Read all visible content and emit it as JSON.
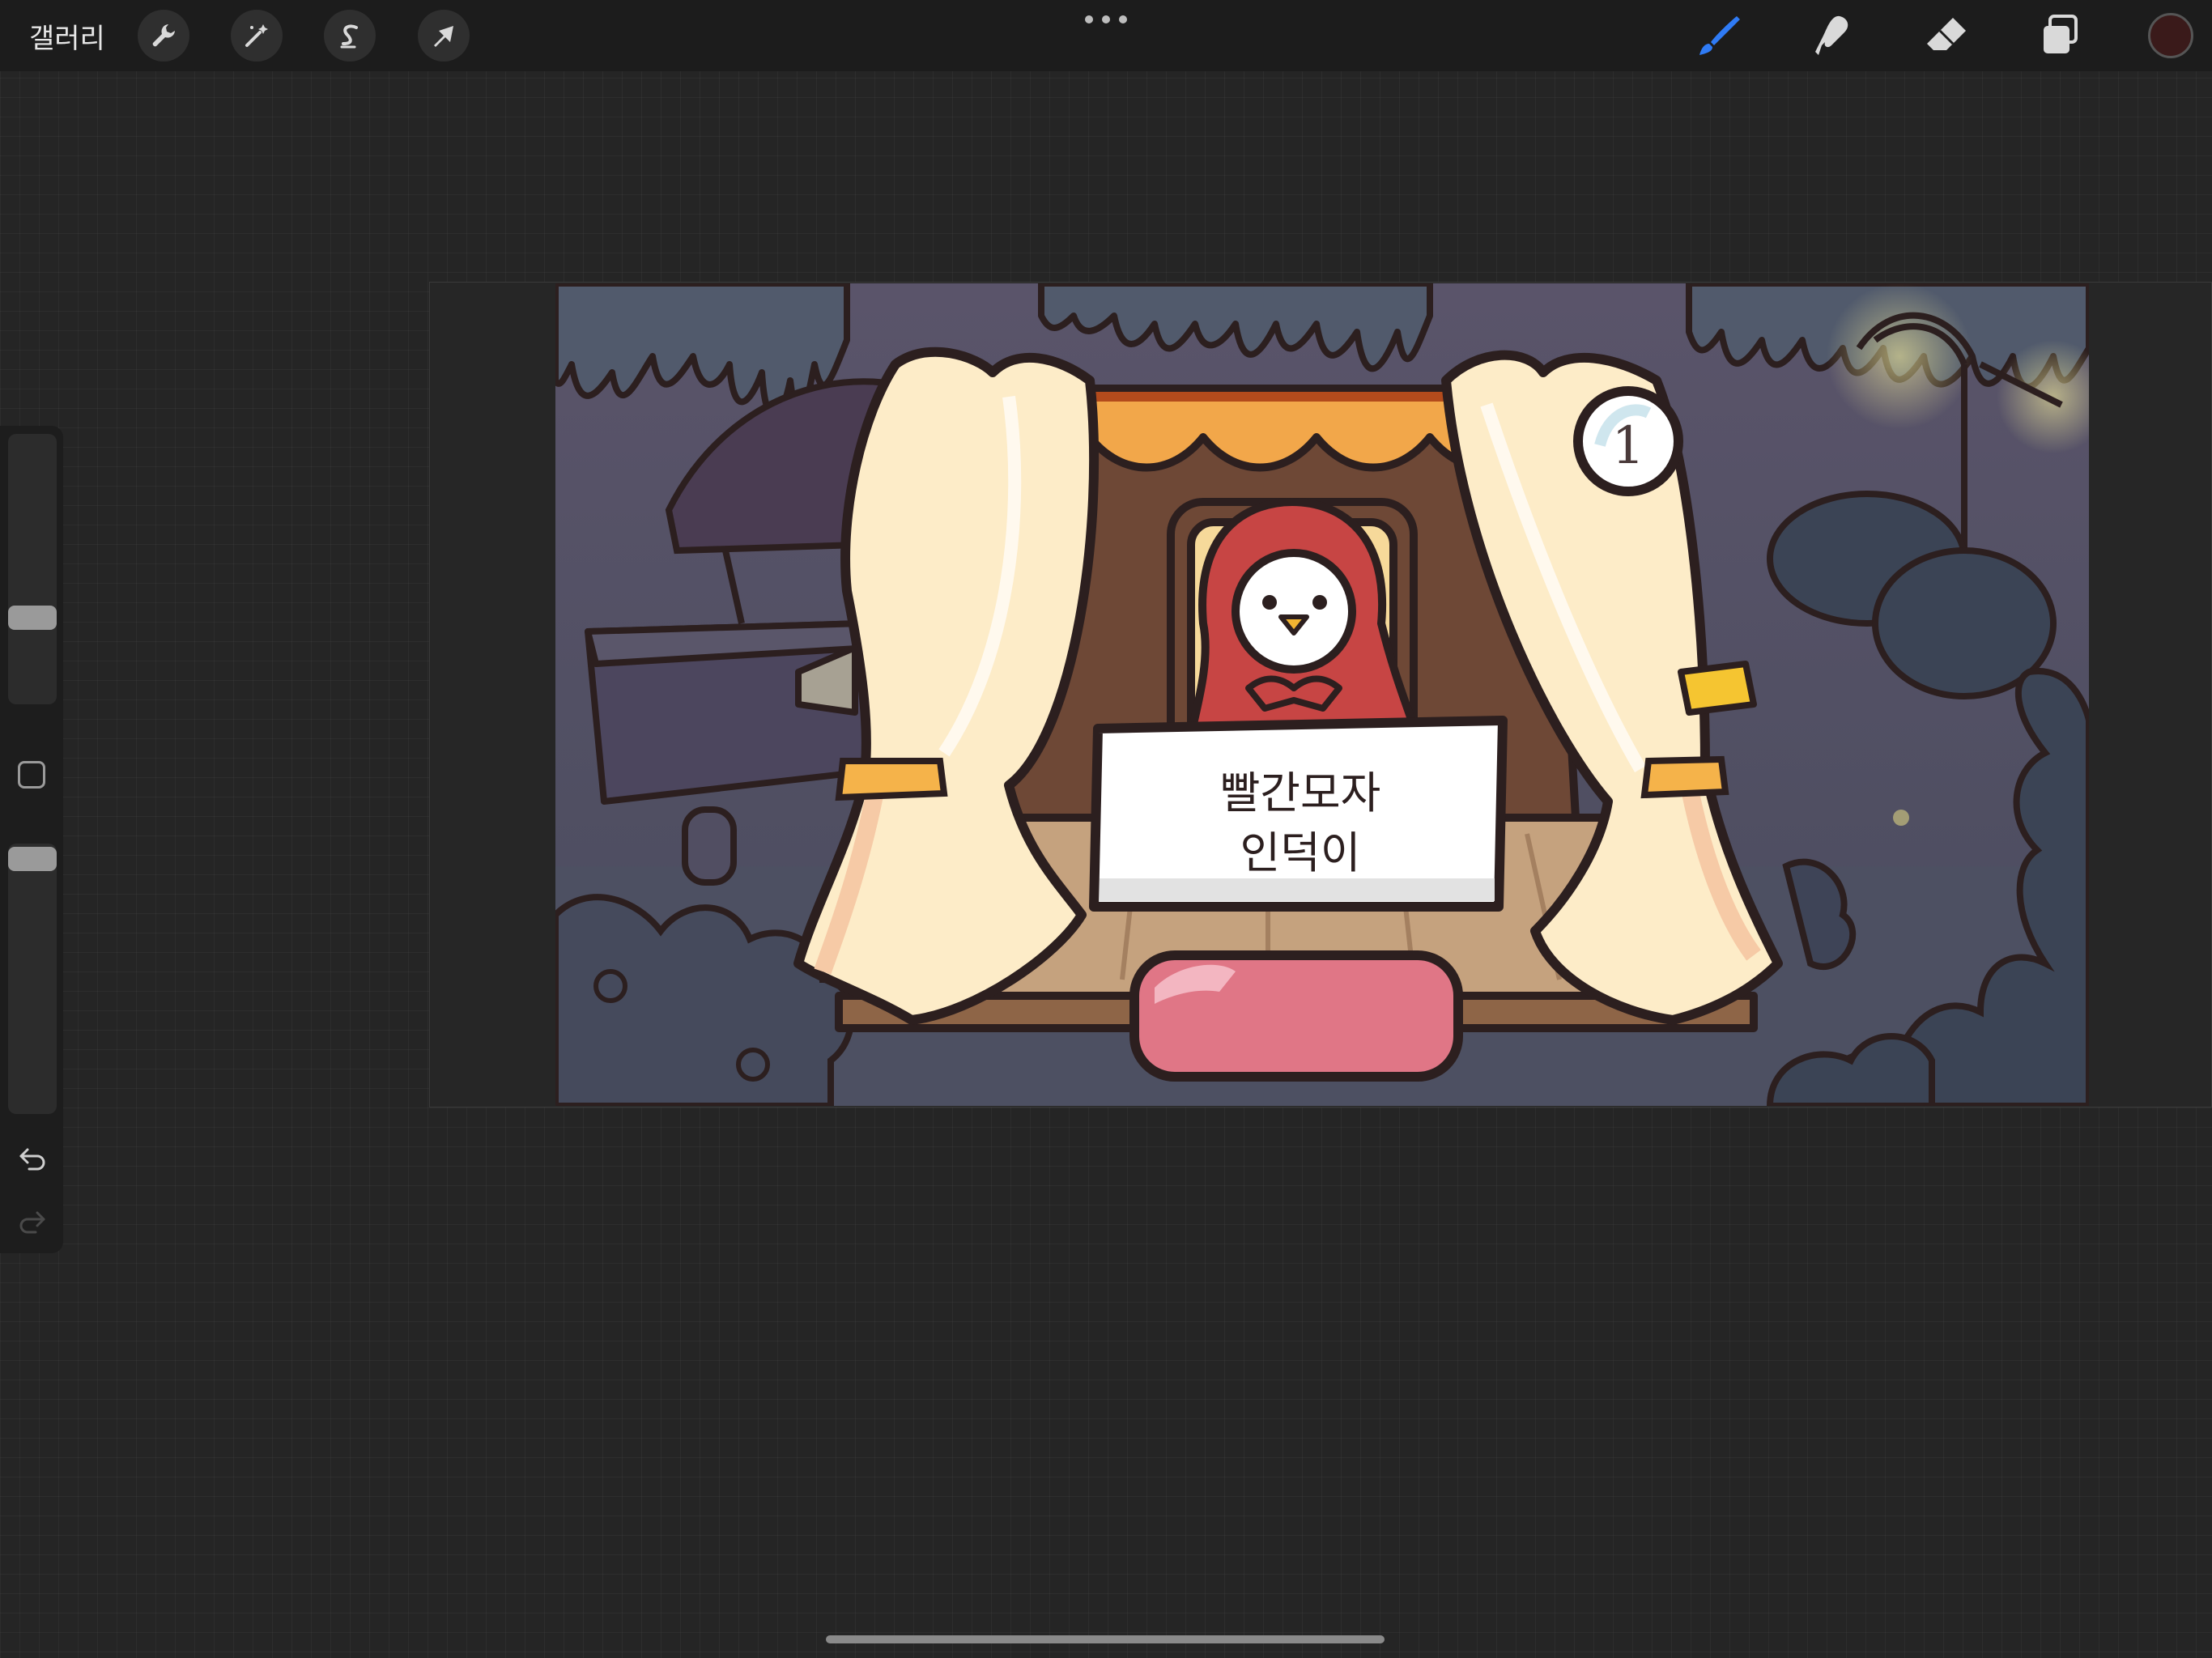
{
  "topbar": {
    "gallery_label": "갤러리",
    "tools": [
      {
        "name": "actions",
        "icon": "wrench-icon"
      },
      {
        "name": "adjustments",
        "icon": "magic-wand-icon"
      },
      {
        "name": "selection",
        "icon": "selection-s-icon"
      },
      {
        "name": "transform",
        "icon": "arrow-cursor-icon"
      }
    ],
    "right_tools": [
      {
        "name": "brush",
        "icon": "brush-icon",
        "active": true
      },
      {
        "name": "smudge",
        "icon": "smudge-icon"
      },
      {
        "name": "eraser",
        "icon": "eraser-icon"
      },
      {
        "name": "layers",
        "icon": "layers-icon"
      }
    ],
    "active_color": "#3a1a1a",
    "accent_color": "#2f7bf5"
  },
  "sidebar": {
    "brush_size_level": 0.35,
    "opacity_level": 0.05
  },
  "artwork": {
    "sign_line1": "빨간모자",
    "sign_line2": "인덕이",
    "medallion_number": "1"
  }
}
